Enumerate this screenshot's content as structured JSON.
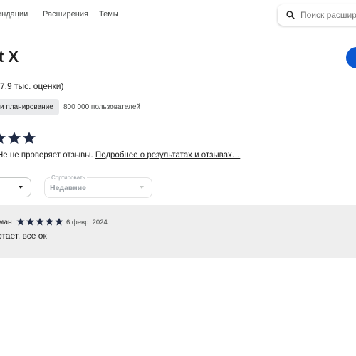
{
  "header": {
    "nav": [
      {
        "label": "ендации"
      },
      {
        "label": "Расширения"
      },
      {
        "label": "Темы"
      }
    ],
    "search": {
      "placeholder": "Поиск расшире",
      "icon": "search-icon"
    }
  },
  "extension": {
    "title": "t X",
    "rating_count": "7,9 тыс. оценки)",
    "category_chip": "и планирование",
    "users": "800 000 пользователей",
    "star_color": "#1f2a44",
    "install_button_color": "#0b57d0"
  },
  "reviews_section": {
    "stars_shown": 3,
    "notice_text": "Не не проверяет отзывы. ",
    "notice_link": "Подробнее о результатах и отзывах…",
    "sort": {
      "label": "Сортировать",
      "value": "Недавние"
    }
  },
  "review": {
    "author": "ман",
    "rating": 5,
    "date": "6 февр. 2024 г.",
    "text": "отает, все ок"
  }
}
